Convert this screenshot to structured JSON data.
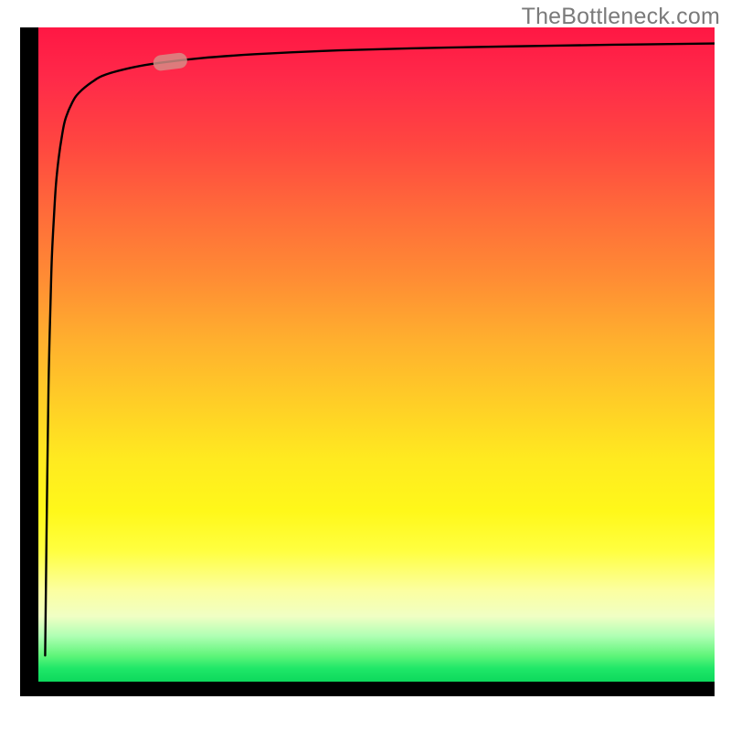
{
  "watermark": "TheBottleneck.com",
  "chart_data": {
    "type": "line",
    "title": "",
    "xlabel": "",
    "ylabel": "",
    "xlim": [
      0,
      100
    ],
    "ylim": [
      0,
      100
    ],
    "grid": false,
    "legend": false,
    "gradient_scale": {
      "direction": "vertical",
      "stops": [
        {
          "pos": 0,
          "color": "#ff1744"
        },
        {
          "pos": 20,
          "color": "#ff4f40"
        },
        {
          "pos": 40,
          "color": "#ff9a30"
        },
        {
          "pos": 60,
          "color": "#ffd024"
        },
        {
          "pos": 75,
          "color": "#fff620"
        },
        {
          "pos": 90,
          "color": "#ccff90"
        },
        {
          "pos": 100,
          "color": "#0dd95c"
        }
      ]
    },
    "series": [
      {
        "name": "curve",
        "x": [
          1.0,
          1.2,
          1.5,
          1.8,
          2.0,
          2.3,
          2.6,
          3.0,
          3.5,
          4.0,
          5.0,
          6.0,
          8.0,
          10.0,
          14.0,
          18.0,
          24.0,
          32.0,
          42.0,
          55.0,
          70.0,
          85.0,
          100.0
        ],
        "y": [
          4.0,
          22.0,
          45.0,
          58.0,
          65.0,
          71.0,
          76.0,
          80.0,
          83.5,
          86.0,
          88.5,
          90.0,
          91.7,
          92.8,
          93.9,
          94.6,
          95.3,
          95.9,
          96.4,
          96.8,
          97.1,
          97.35,
          97.55
        ]
      }
    ],
    "highlight_marker": {
      "on_series": "curve",
      "x_range": [
        17.0,
        22.0
      ],
      "description": "pill-shaped marker on curve",
      "color": "#d68f87"
    }
  }
}
